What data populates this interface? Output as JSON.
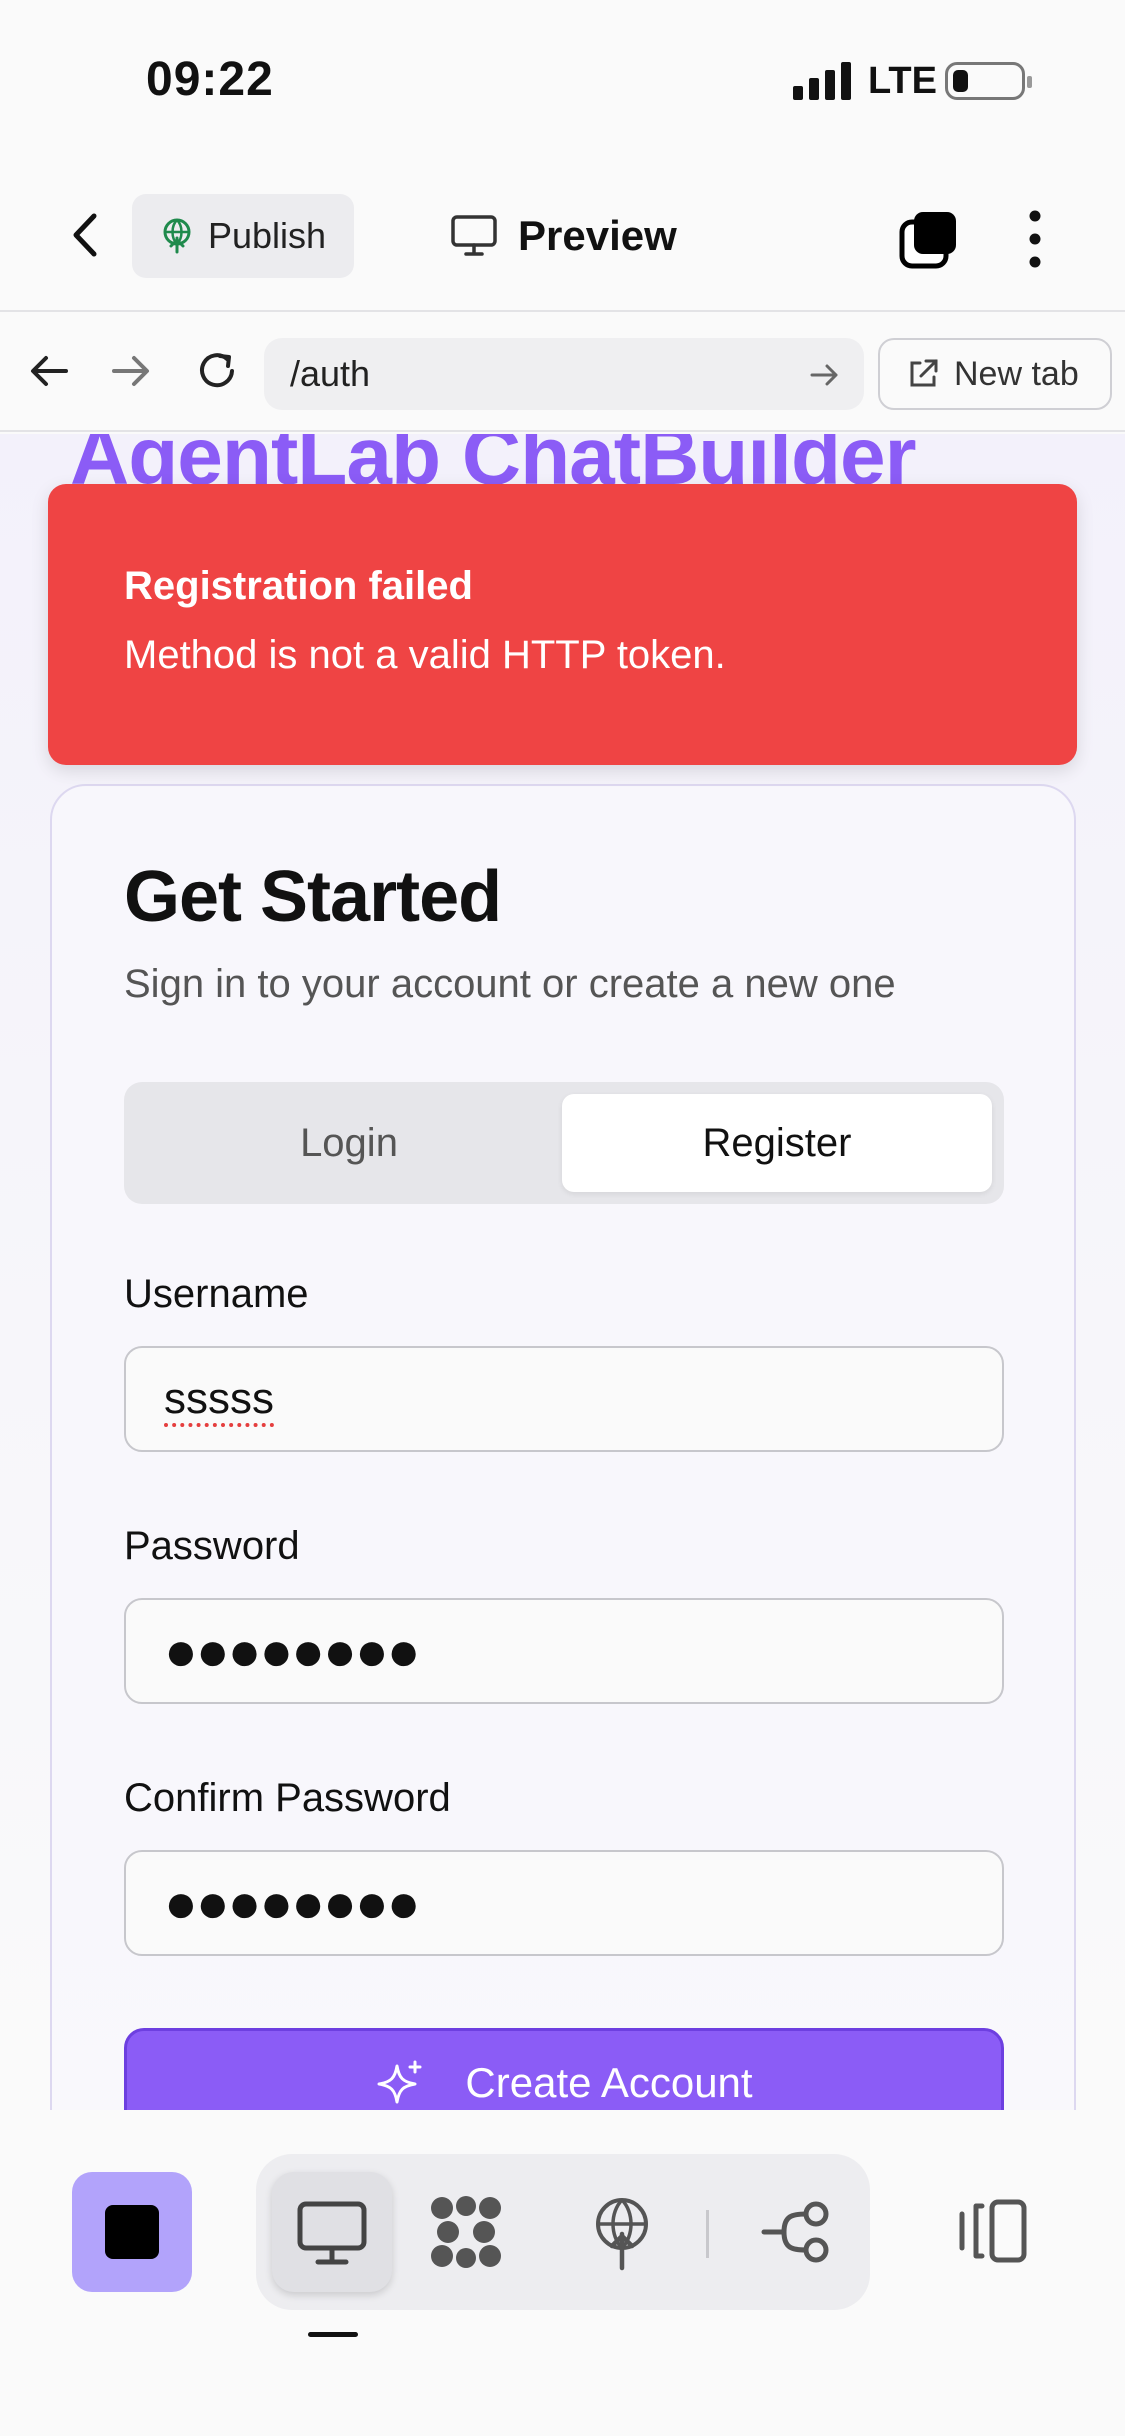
{
  "status_bar": {
    "time": "09:22",
    "network": "LTE"
  },
  "toolbar": {
    "publish_label": "Publish",
    "preview_label": "Preview"
  },
  "browser": {
    "url": "/auth",
    "new_tab_label": "New tab"
  },
  "page": {
    "app_title": "AgentLab ChatBuilder",
    "toast": {
      "title": "Registration failed",
      "message": "Method is not a valid HTTP token."
    },
    "card": {
      "title": "Get Started",
      "subtitle": "Sign in to your account or create a new one",
      "tabs": [
        {
          "label": "Login",
          "active": false
        },
        {
          "label": "Register",
          "active": true
        }
      ],
      "username_label": "Username",
      "username_value": "sssss",
      "password_label": "Password",
      "password_value": "●●●●●●●●",
      "confirm_label": "Confirm Password",
      "confirm_value": "●●●●●●●●",
      "submit_label": "Create Account"
    }
  },
  "colors": {
    "accent": "#8b5cf6",
    "error": "#ef4444",
    "dock_accent": "#b2a3fb"
  },
  "icons": [
    "back-chevron-icon",
    "publish-globe-icon",
    "monitor-icon",
    "layers-icon",
    "more-vertical-icon",
    "arrow-left-icon",
    "arrow-right-icon",
    "reload-icon",
    "url-go-arrow-icon",
    "external-link-icon",
    "sparkles-icon",
    "app-square-icon",
    "desktop-icon",
    "integrations-icon",
    "deploy-icon",
    "workflow-icon",
    "panel-toggle-icon"
  ]
}
